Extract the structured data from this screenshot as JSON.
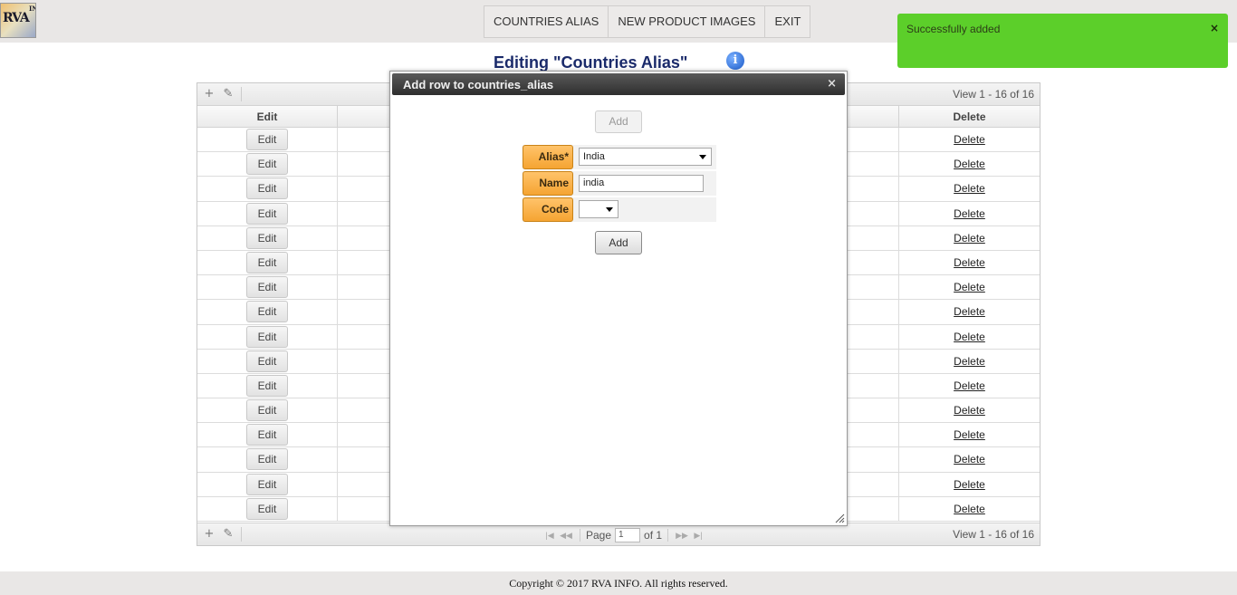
{
  "logo": {
    "text": "RVA",
    "side_text": "INFO"
  },
  "nav": {
    "items": [
      "COUNTRIES ALIAS",
      "NEW PRODUCT IMAGES",
      "EXIT"
    ]
  },
  "toast": {
    "message": "Successfully added",
    "close": "×",
    "color": "#5ccf2a"
  },
  "page": {
    "title": "Editing \"Countries Alias\"",
    "info_icon": "info-icon"
  },
  "grid": {
    "view_info": "View 1 - 16 of 16",
    "columns": [
      "Edit",
      "",
      "Delete"
    ],
    "edit_label": "Edit",
    "delete_label": "Delete",
    "row_count": 16,
    "pager": {
      "page_label": "Page",
      "page_value": "1",
      "of_label": "of 1"
    }
  },
  "modal": {
    "title": "Add row to countries_alias",
    "close": "×",
    "add_top_label": "Add",
    "add_bottom_label": "Add",
    "fields": {
      "alias": {
        "label": "Alias*",
        "value": "India"
      },
      "name": {
        "label": "Name",
        "value": "india"
      },
      "code": {
        "label": "Code",
        "value": ""
      }
    }
  },
  "footer": {
    "text": "Copyright © 2017 RVA INFO. All rights reserved."
  },
  "colors": {
    "label_orange": "#f5a432",
    "title_navy": "#1a2a6a",
    "header_dark": "#2e2e2e"
  }
}
